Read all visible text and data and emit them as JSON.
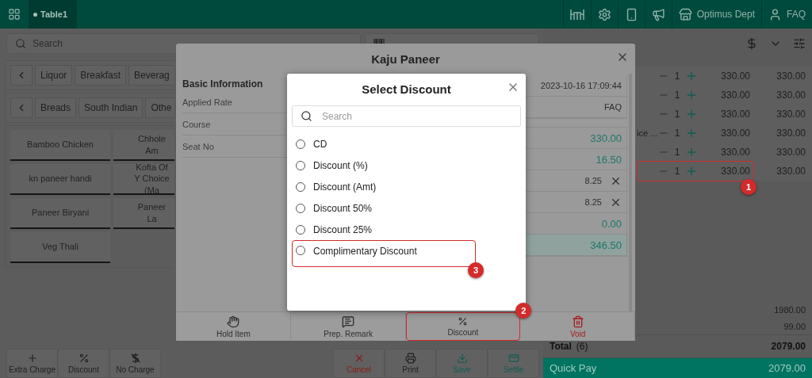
{
  "topbar": {
    "table_tab": "Table1",
    "actions": [
      {
        "kind": "table"
      },
      {
        "kind": "settings"
      },
      {
        "kind": "device"
      },
      {
        "kind": "megaphone"
      },
      {
        "kind": "store",
        "label": "Optimus Dept"
      },
      {
        "kind": "user",
        "label": "FAQ"
      }
    ]
  },
  "search": {
    "placeholder": "Search"
  },
  "category_rows": [
    {
      "items": [
        "Liquor",
        "Breakfast",
        "Beverag"
      ]
    },
    {
      "items": [
        "Breads",
        "South Indian",
        "Othe"
      ]
    }
  ],
  "menu_items": [
    "Bamboo Chicken",
    "Chhole Am",
    "kn paneer handi",
    "Kofta Of Y Choice (Ma",
    "Paneer Biryani",
    "Paneer La",
    "Veg Thali"
  ],
  "left_toolbar": [
    {
      "kind": "plus",
      "label": "Extra Charge"
    },
    {
      "kind": "percent",
      "label": "Discount"
    },
    {
      "kind": "no-charge",
      "label": "No Charge"
    }
  ],
  "right_toolbar": [
    {
      "kind": "cancel",
      "label": "Cancel"
    },
    {
      "kind": "print",
      "label": "Print"
    },
    {
      "kind": "save",
      "label": "Save"
    },
    {
      "kind": "settle",
      "label": "Settle"
    }
  ],
  "order_panel": {
    "lines": [
      {
        "qty": "1",
        "price": "330.00",
        "amount": "330.00"
      },
      {
        "qty": "1",
        "price": "330.00",
        "amount": "330.00"
      },
      {
        "qty": "1",
        "price": "330.00",
        "amount": "330.00"
      },
      {
        "name": "ice ...",
        "qty": "1",
        "price": "330.00",
        "amount": "330.00"
      },
      {
        "qty": "1",
        "price": "330.00",
        "amount": "330.00"
      },
      {
        "qty": "1",
        "price": "330.00",
        "amount": "330.00",
        "callout": "1"
      }
    ],
    "subtotals": [
      "1980.00",
      "99.00"
    ],
    "total": {
      "label": "Total",
      "count": "(6)",
      "amount": "2079.00"
    },
    "quick_pay": {
      "label": "Quick Pay",
      "amount": "2079.00"
    }
  },
  "item_dialog": {
    "title": "Kaju Paneer",
    "section": "Basic Information",
    "info_rows": [
      "Applied Rate",
      "Course",
      "Seat No"
    ],
    "info_values": [
      "2023-10-16 17:09:44",
      "FAQ"
    ],
    "amounts": [
      {
        "kind": "value",
        "value": "330.00"
      },
      {
        "kind": "value",
        "value": "16.50"
      },
      {
        "kind": "removable",
        "value": "8.25"
      },
      {
        "kind": "removable",
        "value": "8.25"
      },
      {
        "kind": "value",
        "value": "0.00"
      },
      {
        "kind": "total",
        "value": "346.50"
      }
    ],
    "actions": [
      {
        "kind": "hold",
        "label": "Hold Item"
      },
      {
        "kind": "remark",
        "label": "Prep. Remark"
      },
      {
        "kind": "discount",
        "label": "Discount",
        "callout": "2"
      },
      {
        "kind": "void",
        "label": "Void"
      }
    ]
  },
  "discount_dialog": {
    "title": "Select Discount",
    "search": {
      "placeholder": "Search"
    },
    "options": [
      {
        "label": "CD",
        "selected": false
      },
      {
        "label": "Discount (%)",
        "selected": false
      },
      {
        "label": "Discount (Amt)",
        "selected": false
      },
      {
        "label": "Discount 50%",
        "selected": false
      },
      {
        "label": "Discount 25%",
        "selected": false
      },
      {
        "label": "Complimentary Discount",
        "selected": false,
        "callout": "3"
      }
    ]
  }
}
